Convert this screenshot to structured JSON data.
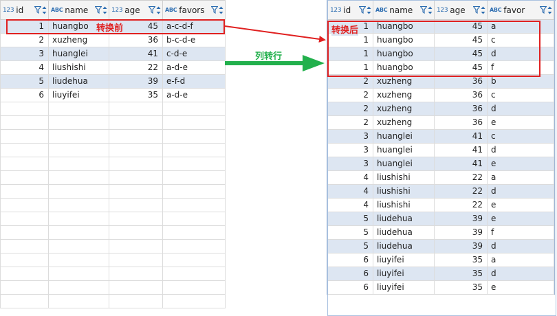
{
  "left_table": {
    "columns": [
      {
        "type": "123",
        "label": "id"
      },
      {
        "type": "ABC",
        "label": "name"
      },
      {
        "type": "123",
        "label": "age"
      },
      {
        "type": "ABC",
        "label": "favors"
      }
    ],
    "rows": [
      [
        "1",
        "huangbo",
        "45",
        "a-c-d-f"
      ],
      [
        "2",
        "xuzheng",
        "36",
        "b-c-d-e"
      ],
      [
        "3",
        "huanglei",
        "41",
        "c-d-e"
      ],
      [
        "4",
        "liushishi",
        "22",
        "a-d-e"
      ],
      [
        "5",
        "liudehua",
        "39",
        "e-f-d"
      ],
      [
        "6",
        "liuyifei",
        "35",
        "a-d-e"
      ]
    ]
  },
  "right_table": {
    "columns": [
      {
        "type": "123",
        "label": "id"
      },
      {
        "type": "ABC",
        "label": "name"
      },
      {
        "type": "123",
        "label": "age"
      },
      {
        "type": "ABC",
        "label": "favor"
      }
    ],
    "rows": [
      [
        "1",
        "huangbo",
        "45",
        "a"
      ],
      [
        "1",
        "huangbo",
        "45",
        "c"
      ],
      [
        "1",
        "huangbo",
        "45",
        "d"
      ],
      [
        "1",
        "huangbo",
        "45",
        "f"
      ],
      [
        "2",
        "xuzheng",
        "36",
        "b"
      ],
      [
        "2",
        "xuzheng",
        "36",
        "c"
      ],
      [
        "2",
        "xuzheng",
        "36",
        "d"
      ],
      [
        "2",
        "xuzheng",
        "36",
        "e"
      ],
      [
        "3",
        "huanglei",
        "41",
        "c"
      ],
      [
        "3",
        "huanglei",
        "41",
        "d"
      ],
      [
        "3",
        "huanglei",
        "41",
        "e"
      ],
      [
        "4",
        "liushishi",
        "22",
        "a"
      ],
      [
        "4",
        "liushishi",
        "22",
        "d"
      ],
      [
        "4",
        "liushishi",
        "22",
        "e"
      ],
      [
        "5",
        "liudehua",
        "39",
        "e"
      ],
      [
        "5",
        "liudehua",
        "39",
        "f"
      ],
      [
        "5",
        "liudehua",
        "39",
        "d"
      ],
      [
        "6",
        "liuyifei",
        "35",
        "a"
      ],
      [
        "6",
        "liuyifei",
        "35",
        "d"
      ],
      [
        "6",
        "liuyifei",
        "35",
        "e"
      ]
    ]
  },
  "annotations": {
    "before_label": "转换前",
    "after_label": "转换后",
    "transform_label": "列转行"
  },
  "colors": {
    "highlight_red": "#e02020",
    "arrow_green": "#22b04c",
    "alt_row": "#dde6f2",
    "type_icon_blue": "#2b6cb0"
  }
}
